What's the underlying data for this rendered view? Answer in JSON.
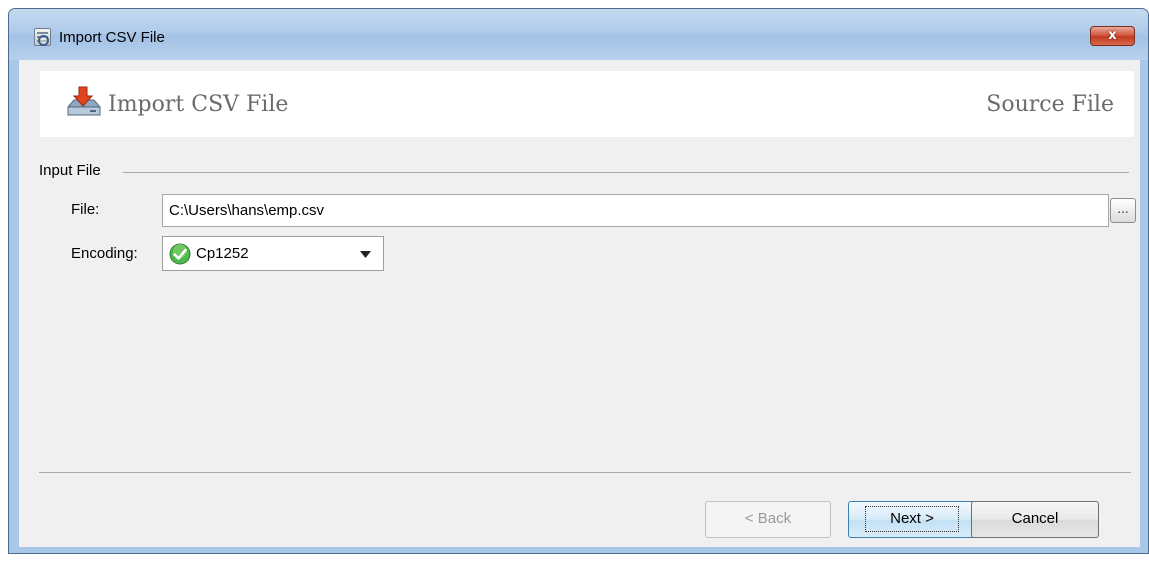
{
  "window": {
    "title": "Import CSV File",
    "close_label": "x"
  },
  "header": {
    "title": "Import CSV File",
    "step": "Source File",
    "icon": "import-arrow-disk-icon"
  },
  "input_file": {
    "group_label": "Input File",
    "file_label": "File:",
    "file_value": "C:\\Users\\hans\\emp.csv",
    "browse_label": "...",
    "encoding_label": "Encoding:",
    "encoding_value": "Cp1252",
    "encoding_status_icon": "check-circle-icon"
  },
  "buttons": {
    "back": "< Back",
    "next": "Next >",
    "cancel": "Cancel"
  },
  "colors": {
    "titlebar": "#aecbea",
    "close": "#c13a1f",
    "dialog_bg": "#f0f0f0",
    "ok_green": "#3aa63a"
  }
}
